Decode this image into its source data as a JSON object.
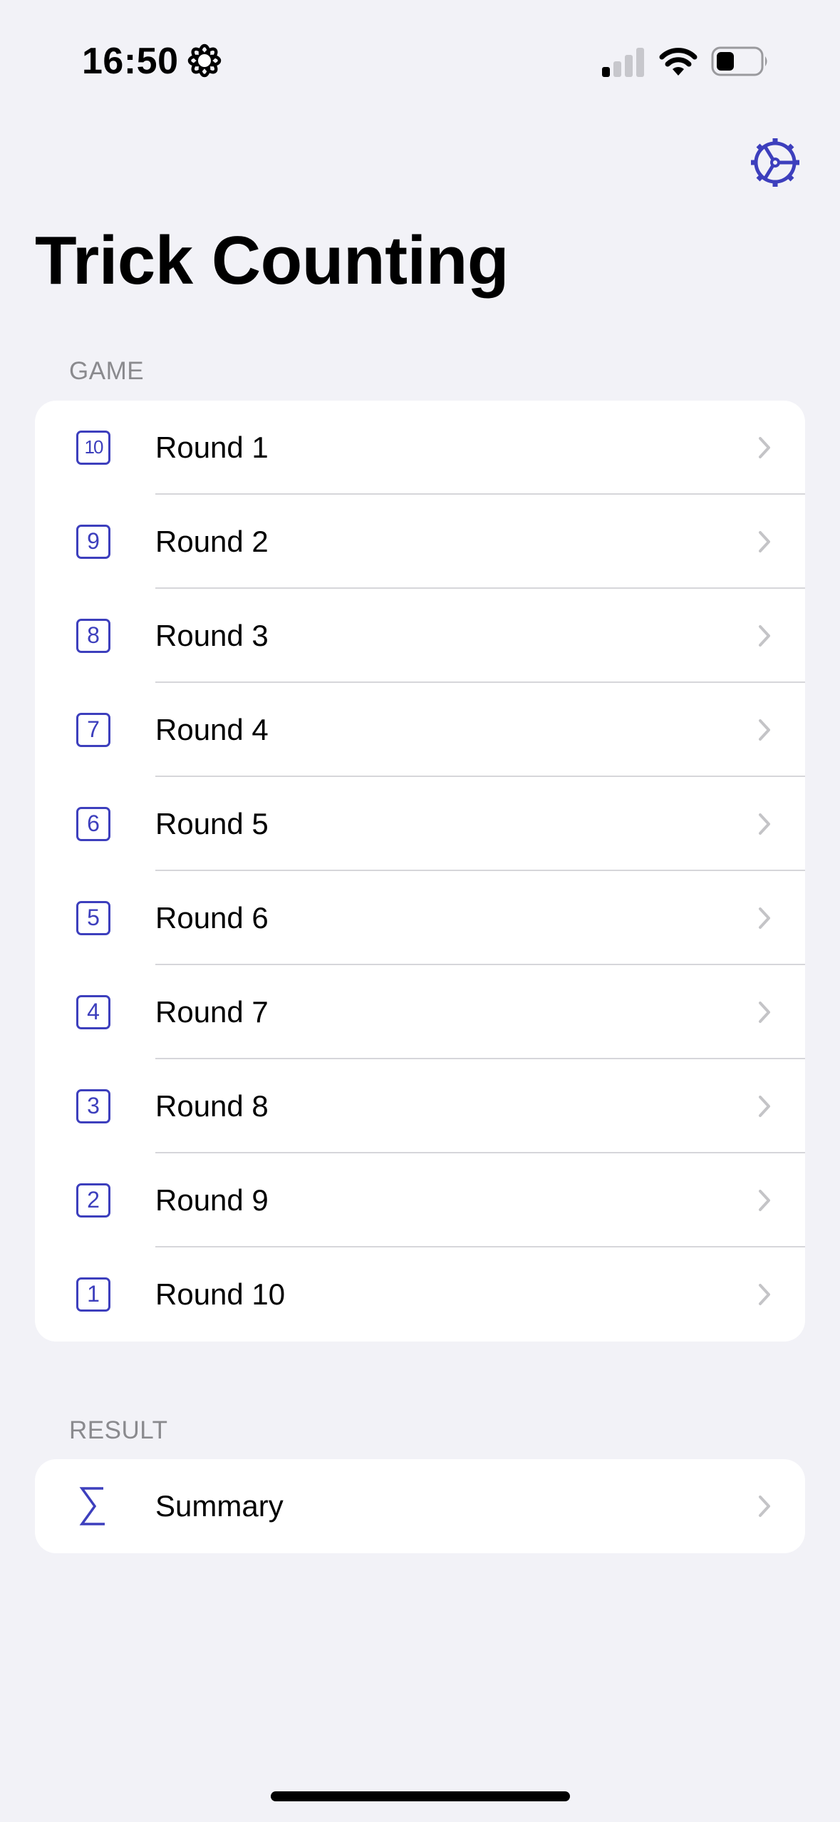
{
  "status_bar": {
    "time": "16:50",
    "focus_icon": "flower-focus-icon",
    "signal_icon": "cellular-signal-icon",
    "wifi_icon": "wifi-icon",
    "battery_icon": "battery-icon"
  },
  "nav": {
    "settings_icon": "gear-icon",
    "title": "Trick Counting"
  },
  "colors": {
    "accent": "#3d3fbd",
    "background": "#f2f2f7",
    "secondary_text": "#8a8a8e",
    "chevron": "#c4c4c7"
  },
  "game_section": {
    "header": "GAME",
    "rows": [
      {
        "badge": "10",
        "label": "Round 1"
      },
      {
        "badge": "9",
        "label": "Round 2"
      },
      {
        "badge": "8",
        "label": "Round 3"
      },
      {
        "badge": "7",
        "label": "Round 4"
      },
      {
        "badge": "6",
        "label": "Round 5"
      },
      {
        "badge": "5",
        "label": "Round 6"
      },
      {
        "badge": "4",
        "label": "Round 7"
      },
      {
        "badge": "3",
        "label": "Round 8"
      },
      {
        "badge": "2",
        "label": "Round 9"
      },
      {
        "badge": "1",
        "label": "Round 10"
      }
    ]
  },
  "result_section": {
    "header": "RESULT",
    "rows": [
      {
        "icon": "sigma-icon",
        "label": "Summary"
      }
    ]
  }
}
